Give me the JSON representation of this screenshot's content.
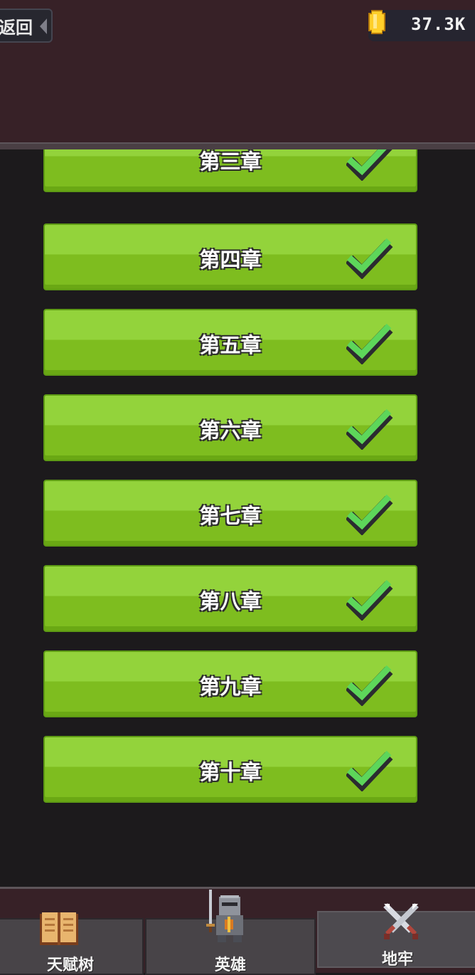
{
  "header": {
    "back_label": "返回",
    "coin_count": "37.3K"
  },
  "chapters": [
    {
      "label": "第三章",
      "completed": true
    },
    {
      "label": "第四章",
      "completed": true
    },
    {
      "label": "第五章",
      "completed": true
    },
    {
      "label": "第六章",
      "completed": true
    },
    {
      "label": "第七章",
      "completed": true
    },
    {
      "label": "第八章",
      "completed": true
    },
    {
      "label": "第九章",
      "completed": true
    },
    {
      "label": "第十章",
      "completed": true
    }
  ],
  "tabs": [
    {
      "label": "天赋树",
      "icon": "book-icon",
      "active": false
    },
    {
      "label": "英雄",
      "icon": "knight-icon",
      "active": false
    },
    {
      "label": "地牢",
      "icon": "crossed-swords-icon",
      "active": true
    }
  ],
  "colors": {
    "header_bg": "#372127",
    "list_bg": "#1c1a1c",
    "chapter_green": "#93d33b",
    "check_green": "#5dd65a"
  }
}
